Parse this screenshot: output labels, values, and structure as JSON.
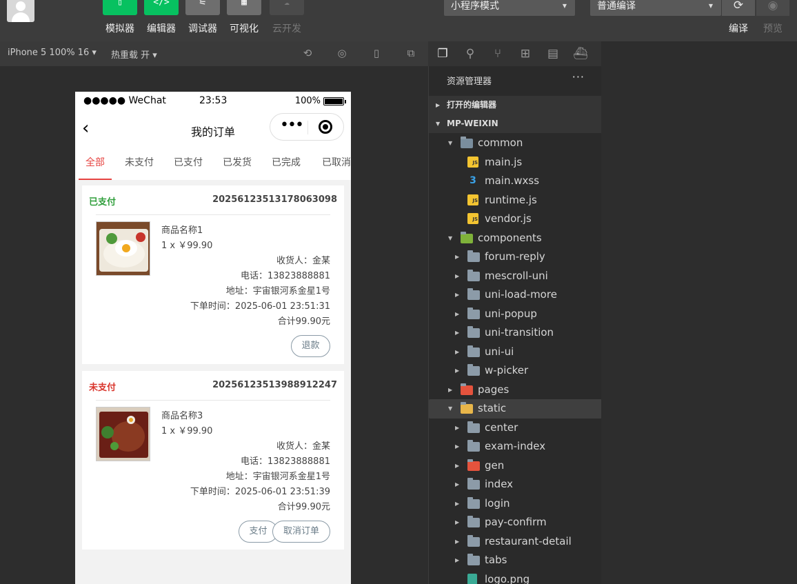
{
  "toolbar": {
    "buttons": [
      {
        "label": "模拟器",
        "glyph": "▯"
      },
      {
        "label": "编辑器",
        "glyph": "</>"
      },
      {
        "label": "调试器",
        "glyph": "⚟"
      },
      {
        "label": "可视化",
        "glyph": "▦"
      },
      {
        "label": "云开发",
        "glyph": "☁"
      }
    ],
    "mode_select": "小程序模式",
    "compile_select": "普通编译",
    "compile_label": "编译",
    "preview_label": "预览"
  },
  "simbar": {
    "device": "iPhone 5 100% 16",
    "hot_reload": "热重载 开"
  },
  "phone": {
    "status": {
      "carrier": "●●●●● WeChat",
      "time": "23:53",
      "battery": "100%"
    },
    "nav_title": "我的订单",
    "tabs": [
      "全部",
      "未支付",
      "已支付",
      "已发货",
      "已完成",
      "已取消"
    ],
    "orders": [
      {
        "status": "已支付",
        "status_color": "#2e9e3a",
        "order_no": "20256123513178063098",
        "product_name": "商品名称1",
        "qty_price": "1 x ￥99.90",
        "receiver": "收货人：金某",
        "phone": "电话：13823888881",
        "address": "地址：宇宙银河系金星1号",
        "time": "下单时间：2025-06-01 23:51:31",
        "total": "合计99.90元",
        "buttons": [
          "退款"
        ]
      },
      {
        "status": "未支付",
        "status_color": "#d9342b",
        "order_no": "20256123513988912247",
        "product_name": "商品名称3",
        "qty_price": "1 x ￥99.90",
        "receiver": "收货人：金某",
        "phone": "电话：13823888881",
        "address": "地址：宇宙银河系金星1号",
        "time": "下单时间：2025-06-01 23:51:39",
        "total": "合计99.90元",
        "buttons": [
          "支付",
          "取消订单"
        ]
      }
    ]
  },
  "explorer": {
    "title": "资源管理器",
    "open_editors": "打开的编辑器",
    "project": "MP-WEIXIN",
    "tree": [
      {
        "label": "common",
        "type": "folder-open"
      },
      {
        "label": "main.js",
        "type": "js"
      },
      {
        "label": "main.wxss",
        "type": "css"
      },
      {
        "label": "runtime.js",
        "type": "js"
      },
      {
        "label": "vendor.js",
        "type": "js"
      },
      {
        "label": "components",
        "type": "folder-green"
      },
      {
        "label": "forum-reply",
        "type": "folder"
      },
      {
        "label": "mescroll-uni",
        "type": "folder"
      },
      {
        "label": "uni-load-more",
        "type": "folder"
      },
      {
        "label": "uni-popup",
        "type": "folder"
      },
      {
        "label": "uni-transition",
        "type": "folder"
      },
      {
        "label": "uni-ui",
        "type": "folder"
      },
      {
        "label": "w-picker",
        "type": "folder"
      },
      {
        "label": "pages",
        "type": "folder-red"
      },
      {
        "label": "static",
        "type": "folder-yellow"
      },
      {
        "label": "center",
        "type": "folder"
      },
      {
        "label": "exam-index",
        "type": "folder"
      },
      {
        "label": "gen",
        "type": "folder-red"
      },
      {
        "label": "index",
        "type": "folder"
      },
      {
        "label": "login",
        "type": "folder"
      },
      {
        "label": "pay-confirm",
        "type": "folder"
      },
      {
        "label": "restaurant-detail",
        "type": "folder"
      },
      {
        "label": "tabs",
        "type": "folder"
      },
      {
        "label": "logo.png",
        "type": "png"
      }
    ]
  }
}
